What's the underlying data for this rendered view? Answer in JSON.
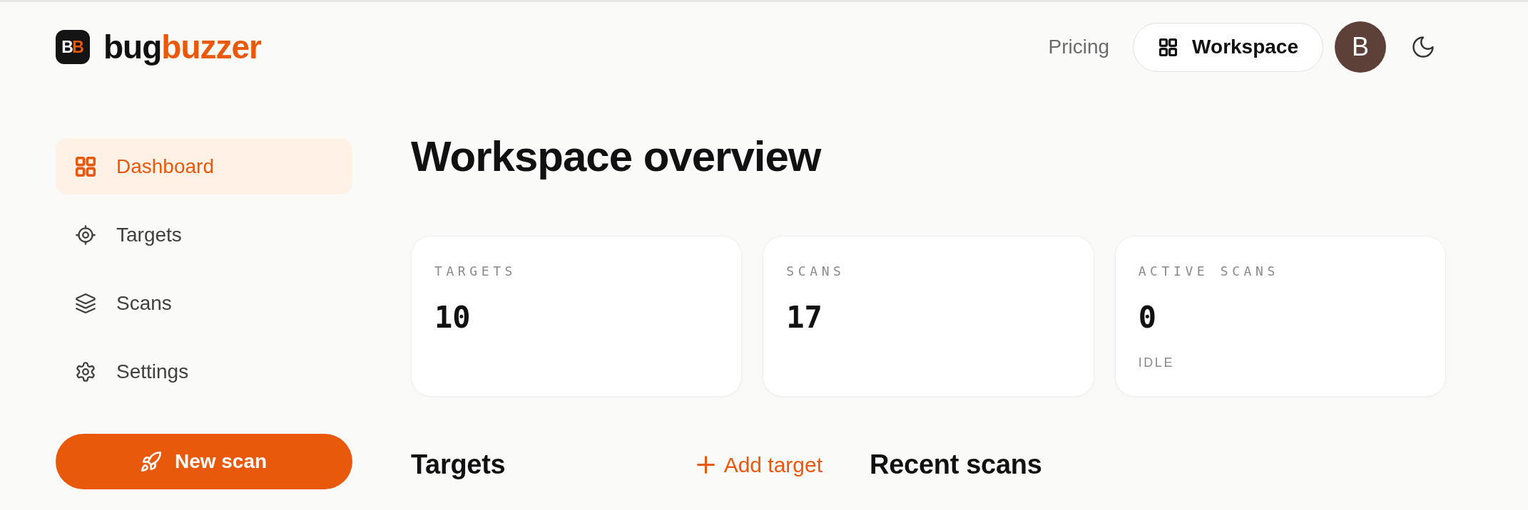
{
  "header": {
    "logo": {
      "mark": [
        "B",
        "B"
      ],
      "name_parts": [
        "bug",
        "buzzer"
      ]
    },
    "nav": {
      "pricing_link": "Pricing",
      "workspace_button": "Workspace",
      "avatar_initial": "B"
    }
  },
  "sidebar": {
    "items": [
      {
        "label": "Dashboard",
        "selected": true
      },
      {
        "label": "Targets",
        "selected": false
      },
      {
        "label": "Scans",
        "selected": false
      },
      {
        "label": "Settings",
        "selected": false
      }
    ],
    "new_scan_button": "New scan"
  },
  "main": {
    "title": "Workspace overview",
    "stats": [
      {
        "label": "TARGETS",
        "value": "10"
      },
      {
        "label": "SCANS",
        "value": "17"
      },
      {
        "label": "ACTIVE SCANS",
        "value": "0",
        "note": "IDLE"
      }
    ],
    "sections": [
      {
        "title": "Targets",
        "action": "Add target"
      },
      {
        "title": "Recent scans"
      }
    ]
  }
}
